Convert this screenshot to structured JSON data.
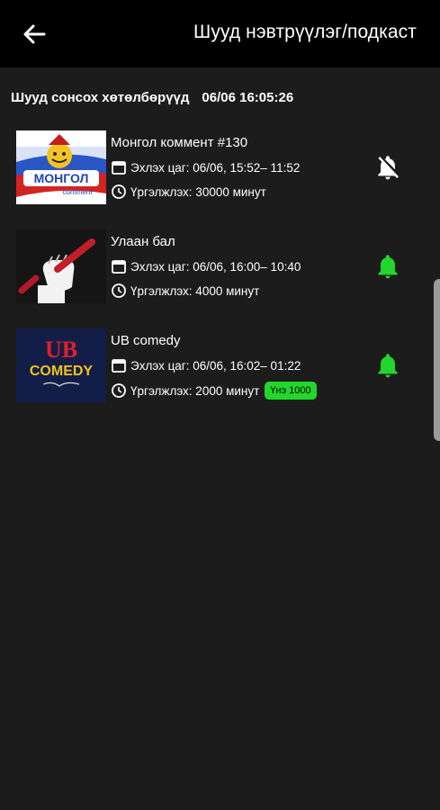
{
  "header": {
    "title": "Шууд нэвтрүүлэг/подкаст",
    "back_icon": "arrow-left-icon"
  },
  "section": {
    "label": "Шууд сонсох хөтөлбөрүүд",
    "timestamp": "06/06 16:05:26"
  },
  "programs": [
    {
      "title": "Монгол коммент #130",
      "start": "Эхлэх цаг: 06/06, 15:52– 11:52",
      "duration": "Үргэлжлэх: 30000 минут",
      "price": "",
      "bell": "bell-off-icon",
      "bell_color": "#ffffff",
      "thumb_text_main": "МОНГОЛ",
      "thumb_text_sub": "comment"
    },
    {
      "title": "Улаан бал",
      "start": "Эхлэх цаг: 06/06, 16:00– 10:40",
      "duration": "Үргэлжлэх: 4000 минут",
      "price": "",
      "bell": "bell-icon",
      "bell_color": "#22d62c"
    },
    {
      "title": "UB comedy",
      "start": "Эхлэх цаг: 06/06, 16:02– 01:22",
      "duration": "Үргэлжлэх: 2000 минут",
      "price": "Үнэ 1000",
      "bell": "bell-icon",
      "bell_color": "#22d62c",
      "thumb_text_main": "UB",
      "thumb_text_sub": "COMEDY"
    }
  ],
  "colors": {
    "background": "#1c1c1c",
    "topbar": "#000000",
    "accent_green": "#22d62c"
  }
}
